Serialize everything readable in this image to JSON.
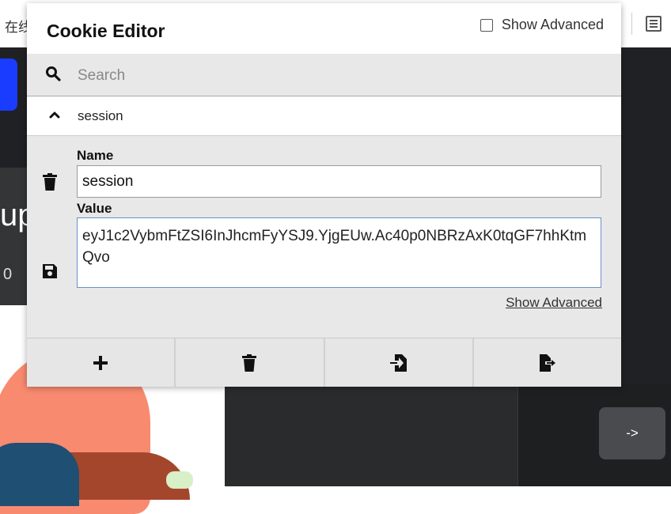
{
  "background": {
    "tab_text": "在线",
    "big_text": "up",
    "small_text": "0",
    "arrow_button": "->"
  },
  "popup": {
    "title": "Cookie Editor",
    "show_advanced_label": "Show Advanced",
    "show_advanced_checked": false
  },
  "search": {
    "placeholder": "Search",
    "value": ""
  },
  "cookie": {
    "header_name": "session",
    "name_label": "Name",
    "name_value": "session",
    "value_label": "Value",
    "value": "eyJ1c2VybmFtZSI6InJhcmFyYSJ9.YjgEUw.Ac40p0NBRzAxK0tqGF7hhKtmQvo",
    "show_advanced_link": "Show Advanced"
  },
  "toolbar": {
    "icons": [
      "plus-icon",
      "trash-icon",
      "import-icon",
      "export-icon"
    ]
  },
  "colors": {
    "accent_blue": "#1a3cff",
    "popup_bg": "#e8e8e8",
    "value_border": "#6a8fc7"
  }
}
